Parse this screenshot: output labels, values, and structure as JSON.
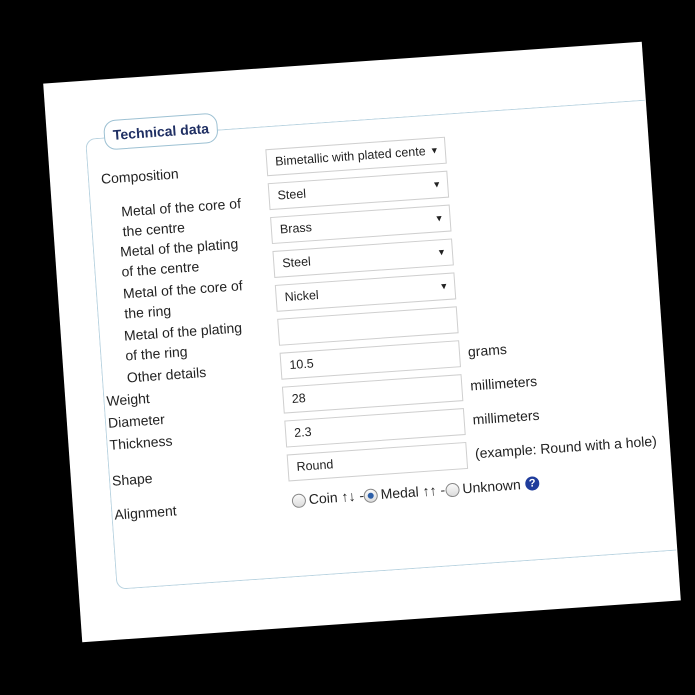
{
  "section": {
    "legend": "Technical data"
  },
  "composition": {
    "label": "Composition",
    "value": "Bimetallic with plated center and"
  },
  "core_centre": {
    "label_line1": "Metal of the core of",
    "label_line2": "the centre",
    "value": "Steel"
  },
  "plating_centre": {
    "label_line1": "Metal of the plating",
    "label_line2": "of the centre",
    "value": "Brass"
  },
  "core_ring": {
    "label_line1": "Metal of the core of",
    "label_line2": "the ring",
    "value": "Steel"
  },
  "plating_ring": {
    "label_line1": "Metal of the plating",
    "label_line2": "of the ring",
    "value": "Nickel"
  },
  "other_details": {
    "label": "Other details",
    "value": ""
  },
  "weight": {
    "label": "Weight",
    "value": "10.5",
    "unit": "grams"
  },
  "diameter": {
    "label": "Diameter",
    "value": "28",
    "unit": "millimeters"
  },
  "thickness": {
    "label": "Thickness",
    "value": "2.3",
    "unit": "millimeters"
  },
  "shape": {
    "label": "Shape",
    "value": "Round",
    "hint": "(example: Round with a hole)"
  },
  "alignment": {
    "label": "Alignment",
    "options": [
      {
        "label": "Coin ↑↓ -",
        "selected": false
      },
      {
        "label": "Medal ↑↑ -",
        "selected": true
      },
      {
        "label": "Unknown",
        "selected": false
      }
    ],
    "help_icon": "?"
  }
}
